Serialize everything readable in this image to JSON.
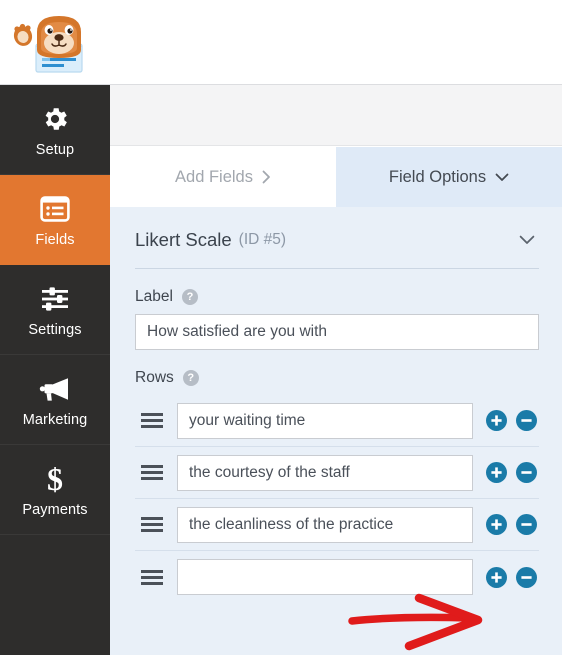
{
  "app": {
    "logo_icon": "wpforms-bear-mascot-logo",
    "accent_orange": "#e27730",
    "accent_blue": "#1a7ba8",
    "panel_bg": "#e9f0f8",
    "sidebar_bg": "#2e2d2c",
    "annotation_color": "#e01b1b"
  },
  "sidebar": {
    "items": [
      {
        "label": "Setup",
        "icon": "gear-icon",
        "active": false
      },
      {
        "label": "Fields",
        "icon": "list-icon",
        "active": true
      },
      {
        "label": "Settings",
        "icon": "sliders-icon",
        "active": false
      },
      {
        "label": "Marketing",
        "icon": "megaphone-icon",
        "active": false
      },
      {
        "label": "Payments",
        "icon": "dollar-icon",
        "active": false
      }
    ]
  },
  "tabs": [
    {
      "label": "Add Fields",
      "icon": "chevron-right-icon",
      "active": false
    },
    {
      "label": "Field Options",
      "icon": "chevron-down-icon",
      "active": true
    }
  ],
  "field_options": {
    "title": "Likert Scale",
    "id_text": "(ID #5)",
    "collapse_icon": "chevron-down-icon",
    "label_section": {
      "label": "Label",
      "help_icon": "help-icon",
      "value": "How satisfied are you with",
      "placeholder": ""
    },
    "rows_section": {
      "label": "Rows",
      "help_icon": "help-icon",
      "add_icon": "plus-circle-icon",
      "remove_icon": "minus-circle-icon",
      "drag_icon": "drag-handle-icon",
      "rows": [
        {
          "value": "your waiting time",
          "placeholder": ""
        },
        {
          "value": "the courtesy of the staff",
          "placeholder": ""
        },
        {
          "value": "the cleanliness of the practice",
          "placeholder": ""
        },
        {
          "value": "",
          "placeholder": ""
        }
      ]
    }
  },
  "annotation": {
    "type": "arrow",
    "direction": "right",
    "points_to": "add-row-button-row-4"
  }
}
